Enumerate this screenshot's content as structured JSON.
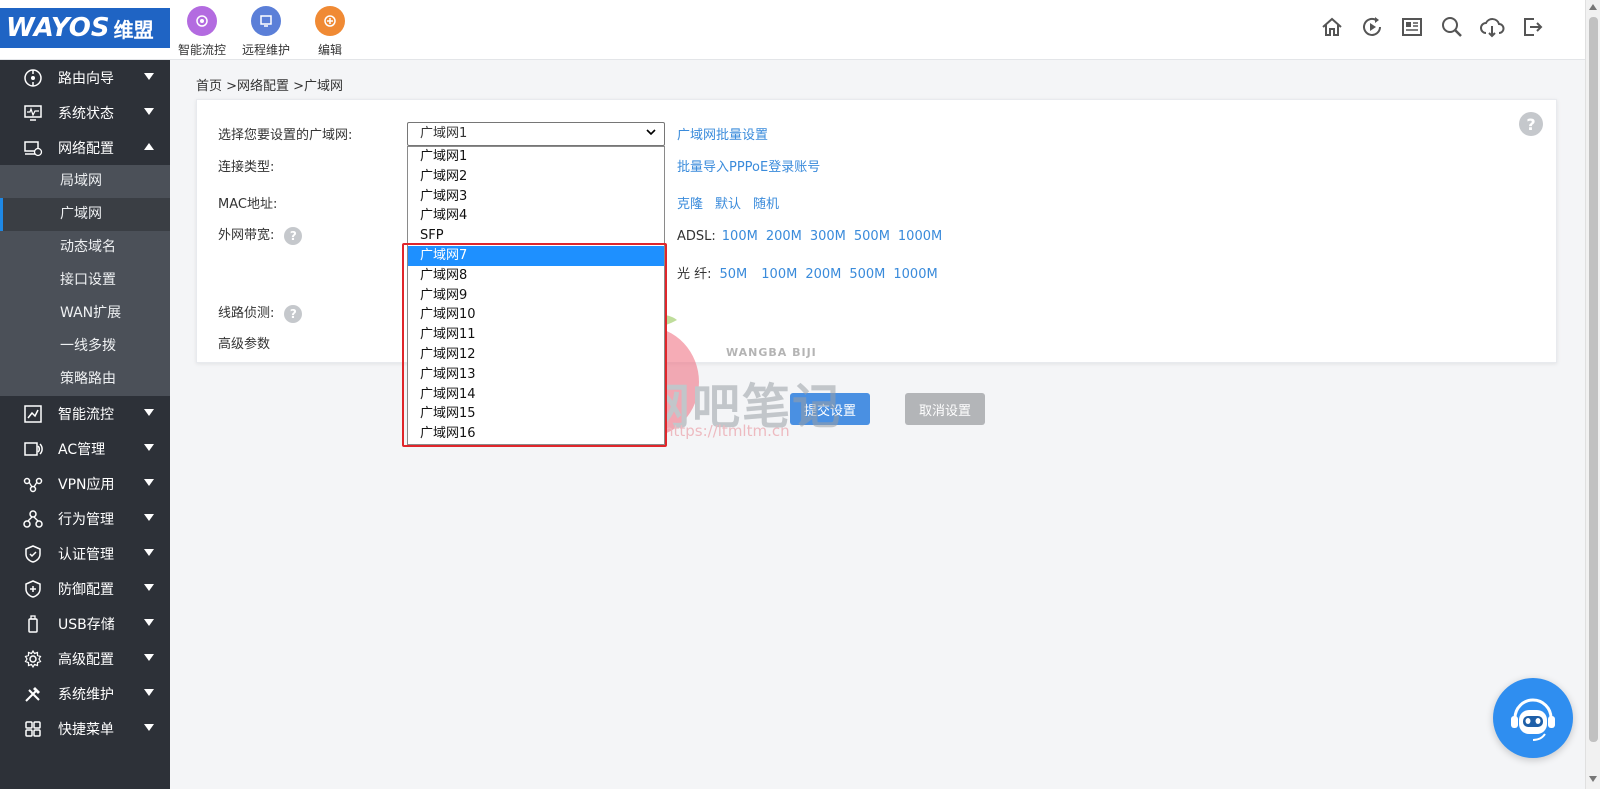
{
  "brand": {
    "logo_text": "WAYOS",
    "logo_cn": "维盟"
  },
  "quick_actions": [
    {
      "label": "智能流控",
      "color": "#b36be0"
    },
    {
      "label": "远程维护",
      "color": "#5b7fd8"
    },
    {
      "label": "编辑",
      "color": "#f08a34"
    }
  ],
  "top_icons": [
    "home-icon",
    "refresh-play-icon",
    "news-icon",
    "search-icon",
    "cloud-download-icon",
    "logout-icon"
  ],
  "sidebar": {
    "items": [
      {
        "label": "路由向导",
        "icon": "wizard-icon"
      },
      {
        "label": "系统状态",
        "icon": "monitor-icon"
      },
      {
        "label": "网络配置",
        "icon": "network-icon",
        "expanded": true
      },
      {
        "label": "智能流控",
        "icon": "flow-icon"
      },
      {
        "label": "AC管理",
        "icon": "ac-icon"
      },
      {
        "label": "VPN应用",
        "icon": "vpn-icon"
      },
      {
        "label": "行为管理",
        "icon": "behavior-icon"
      },
      {
        "label": "认证管理",
        "icon": "shield-check-icon"
      },
      {
        "label": "防御配置",
        "icon": "shield-plus-icon"
      },
      {
        "label": "USB存储",
        "icon": "usb-icon"
      },
      {
        "label": "高级配置",
        "icon": "gear-icon"
      },
      {
        "label": "系统维护",
        "icon": "tools-icon"
      },
      {
        "label": "快捷菜单",
        "icon": "grid-icon"
      }
    ],
    "sub_items": [
      "局域网",
      "广域网",
      "动态域名",
      "接口设置",
      "WAN扩展",
      "一线多拨",
      "策略路由"
    ]
  },
  "breadcrumb": "首页 >网络配置 >广域网",
  "form": {
    "select_wan_label": "选择您要设置的广域网:",
    "selected_value": "广域网1",
    "conn_type_label": "连接类型:",
    "mac_label": "MAC地址:",
    "bandwidth_label": "外网带宽:",
    "line_detect_label": "线路侦测:",
    "advanced_label": "高级参数"
  },
  "links": {
    "batch_settings": "广域网批量设置",
    "import_pppoe": "批量导入PPPoE登录账号",
    "mac_actions": [
      "克隆",
      "默认",
      "随机"
    ],
    "adsl_label": "ADSL:",
    "adsl_options": [
      "100M",
      "200M",
      "300M",
      "500M",
      "1000M"
    ],
    "fiber_label": "光 纤:",
    "fiber_options": [
      "50M",
      "100M",
      "200M",
      "500M",
      "1000M"
    ]
  },
  "dropdown_options": [
    "广域网1",
    "广域网2",
    "广域网3",
    "广域网4",
    "SFP",
    "广域网7",
    "广域网8",
    "广域网9",
    "广域网10",
    "广域网11",
    "广域网12",
    "广域网13",
    "广域网14",
    "广域网15",
    "广域网16"
  ],
  "highlighted_option": "广域网7",
  "buttons": {
    "submit": "提交设置",
    "cancel": "取消设置"
  },
  "watermark": {
    "title": "网吧笔记",
    "url": "https://ltmltm.cn",
    "sub": "WANGBA BIJI"
  },
  "colors": {
    "accent": "#3a8bdb",
    "sidebar_bg": "#2d3138",
    "highlight_box": "#e0262b"
  }
}
